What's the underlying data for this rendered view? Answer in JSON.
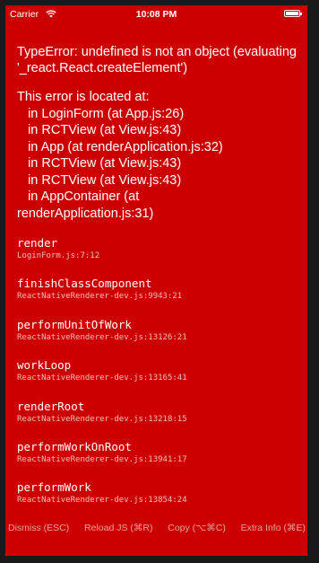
{
  "status_bar": {
    "carrier": "Carrier",
    "wifi_icon": "wifi-icon",
    "time": "10:08 PM",
    "battery_icon": "battery-icon"
  },
  "error": {
    "message": "TypeError: undefined is not an object (evaluating '_react.React.createElement')",
    "location_header": "This error is located at:",
    "location_lines": [
      "   in LoginForm (at App.js:26)",
      "   in RCTView (at View.js:43)",
      "   in App (at renderApplication.js:32)",
      "   in RCTView (at View.js:43)",
      "   in RCTView (at View.js:43)",
      "   in AppContainer (at",
      "renderApplication.js:31)"
    ]
  },
  "stack": [
    {
      "fn": "render",
      "file": "LoginForm.js:7:12"
    },
    {
      "fn": "finishClassComponent",
      "file": "ReactNativeRenderer-dev.js:9943:21"
    },
    {
      "fn": "performUnitOfWork",
      "file": "ReactNativeRenderer-dev.js:13126:21"
    },
    {
      "fn": "workLoop",
      "file": "ReactNativeRenderer-dev.js:13165:41"
    },
    {
      "fn": "renderRoot",
      "file": "ReactNativeRenderer-dev.js:13218:15"
    },
    {
      "fn": "performWorkOnRoot",
      "file": "ReactNativeRenderer-dev.js:13941:17"
    },
    {
      "fn": "performWork",
      "file": "ReactNativeRenderer-dev.js:13854:24"
    }
  ],
  "toolbar": {
    "dismiss": "Dismiss (ESC)",
    "reload": "Reload JS (⌘R)",
    "copy": "Copy (⌥⌘C)",
    "extra_info": "Extra Info (⌘E)"
  },
  "colors": {
    "background": "#cc0000",
    "text": "#ffffff"
  }
}
